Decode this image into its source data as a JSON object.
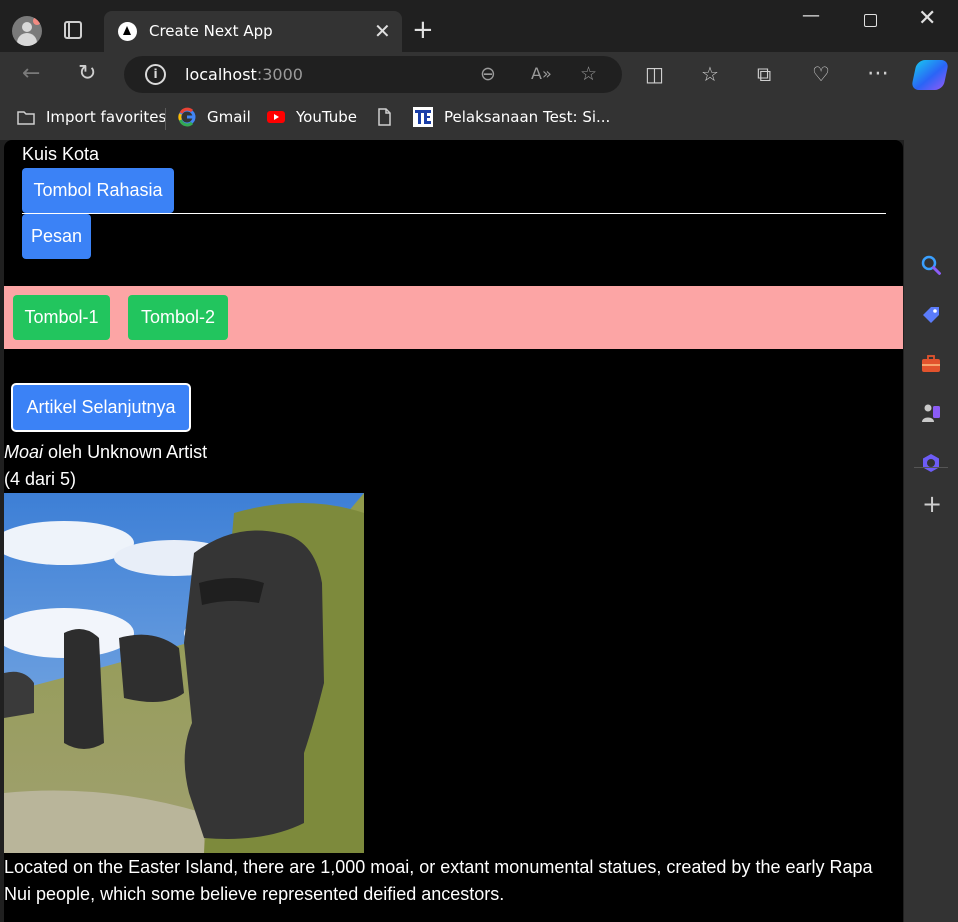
{
  "browser": {
    "tab_title": "Create Next App",
    "url_host": "localhost",
    "url_port": ":3000",
    "favorites": [
      {
        "label": "Import favorites",
        "icon": "import-icon"
      },
      {
        "label": "Gmail",
        "icon": "google-icon"
      },
      {
        "label": "YouTube",
        "icon": "youtube-icon"
      },
      {
        "label": "",
        "icon": "document-icon"
      },
      {
        "label": "Pelaksanaan Test: Si...",
        "icon": "te-icon"
      }
    ]
  },
  "page": {
    "quiz_title": "Kuis Kota",
    "secret_button": "Tombol Rahasia",
    "message_button": "Pesan",
    "button_1": "Tombol-1",
    "button_2": "Tombol-2",
    "next_article_button": "Artikel Selanjutnya",
    "artwork_name": "Moai",
    "artist_prefix": " oleh ",
    "artist_name": "Unknown Artist",
    "counter": "(4 dari 5)",
    "description": "Located on the Easter Island, there are 1,000 moai, or extant monumental statues, created by the early Rapa Nui people, which some believe represented deified ancestors."
  },
  "colors": {
    "primary_button": "#3b82f6",
    "secondary_button": "#22c55e",
    "band": "#fca5a5",
    "page_background": "#000000"
  }
}
